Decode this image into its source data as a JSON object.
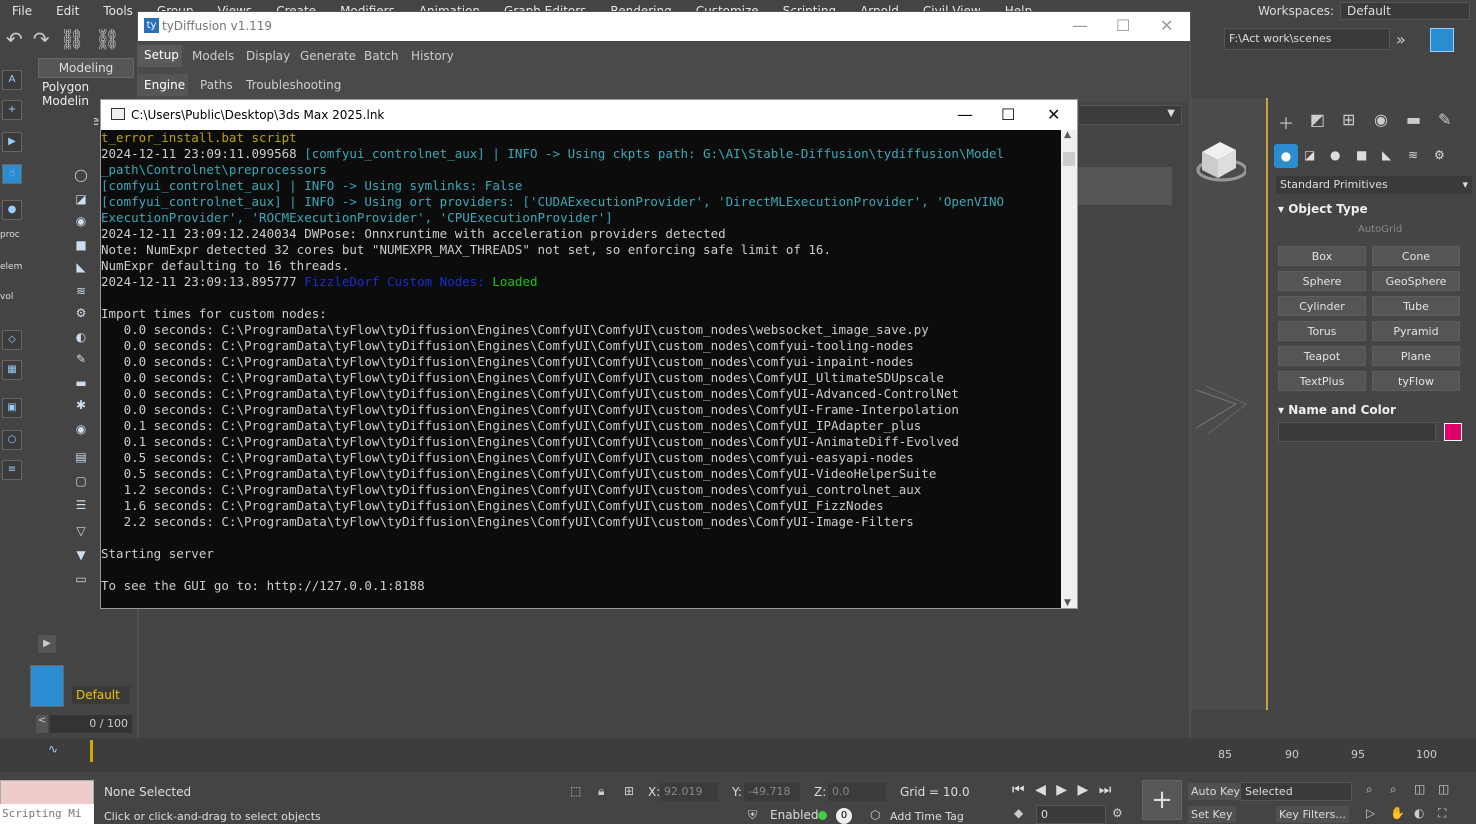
{
  "menubar": {
    "items": [
      "File",
      "Edit",
      "Tools",
      "Group",
      "Views",
      "Create",
      "Modifiers",
      "Animation",
      "Graph Editors",
      "Rendering",
      "Customize",
      "Scripting",
      "Arnold",
      "Civil View",
      "Help"
    ],
    "workspaces_label": "Workspaces:",
    "workspace": "Default"
  },
  "toolbar": {
    "path": "F:\\Act work\\scenes"
  },
  "ribbon": {
    "tab1": "Modeling",
    "tab2": "Polygon Modelin",
    "sel": "Se"
  },
  "lefticons": {
    "proc": "proc",
    "elem": "elem",
    "vol": "vol"
  },
  "cmd": {
    "default": "Default",
    "frame": "0 / 100"
  },
  "tydiffusion": {
    "title": "tyDiffusion v1.119",
    "tabs": [
      "Setup",
      "Models",
      "Display",
      "Generate",
      "Batch",
      "History"
    ],
    "subtabs": [
      "Engine",
      "Paths",
      "Troubleshooting"
    ]
  },
  "console": {
    "title": "C:\\Users\\Public\\Desktop\\3ds Max 2025.lnk",
    "lines": [
      {
        "cls": "dy",
        "text": "t_error_install.bat script"
      },
      {
        "parts": [
          {
            "c": "",
            "t": "2024-12-11 23:09:11.099568 "
          },
          {
            "c": "cy",
            "t": "[comfyui_controlnet_aux] | INFO -> Using ckpts path: G:\\AI\\Stable-Diffusion\\tydiffusion\\Model"
          }
        ]
      },
      {
        "cls": "cy",
        "text": "_path\\Controlnet\\preprocessors"
      },
      {
        "cls": "cy",
        "text": "[comfyui_controlnet_aux] | INFO -> Using symlinks: False"
      },
      {
        "cls": "cy",
        "text": "[comfyui_controlnet_aux] | INFO -> Using ort providers: ['CUDAExecutionProvider', 'DirectMLExecutionProvider', 'OpenVINO"
      },
      {
        "cls": "cy",
        "text": "ExecutionProvider', 'ROCMExecutionProvider', 'CPUExecutionProvider']"
      },
      {
        "cls": "",
        "text": "2024-12-11 23:09:12.240034 DWPose: Onnxruntime with acceleration providers detected"
      },
      {
        "cls": "",
        "text": "Note: NumExpr detected 32 cores but \"NUMEXPR_MAX_THREADS\" not set, so enforcing safe limit of 16."
      },
      {
        "cls": "",
        "text": "NumExpr defaulting to 16 threads."
      },
      {
        "parts": [
          {
            "c": "",
            "t": "2024-12-11 23:09:13.895777 "
          },
          {
            "c": "bl",
            "t": "FizzleDorf Custom Nodes: "
          },
          {
            "c": "gr",
            "t": "Loaded"
          }
        ]
      },
      {
        "cls": "",
        "text": ""
      },
      {
        "cls": "",
        "text": "Import times for custom nodes:"
      },
      {
        "cls": "",
        "text": "   0.0 seconds: C:\\ProgramData\\tyFlow\\tyDiffusion\\Engines\\ComfyUI\\ComfyUI\\custom_nodes\\websocket_image_save.py"
      },
      {
        "cls": "",
        "text": "   0.0 seconds: C:\\ProgramData\\tyFlow\\tyDiffusion\\Engines\\ComfyUI\\ComfyUI\\custom_nodes\\comfyui-tooling-nodes"
      },
      {
        "cls": "",
        "text": "   0.0 seconds: C:\\ProgramData\\tyFlow\\tyDiffusion\\Engines\\ComfyUI\\ComfyUI\\custom_nodes\\comfyui-inpaint-nodes"
      },
      {
        "cls": "",
        "text": "   0.0 seconds: C:\\ProgramData\\tyFlow\\tyDiffusion\\Engines\\ComfyUI\\ComfyUI\\custom_nodes\\ComfyUI_UltimateSDUpscale"
      },
      {
        "cls": "",
        "text": "   0.0 seconds: C:\\ProgramData\\tyFlow\\tyDiffusion\\Engines\\ComfyUI\\ComfyUI\\custom_nodes\\ComfyUI-Advanced-ControlNet"
      },
      {
        "cls": "",
        "text": "   0.0 seconds: C:\\ProgramData\\tyFlow\\tyDiffusion\\Engines\\ComfyUI\\ComfyUI\\custom_nodes\\ComfyUI-Frame-Interpolation"
      },
      {
        "cls": "",
        "text": "   0.1 seconds: C:\\ProgramData\\tyFlow\\tyDiffusion\\Engines\\ComfyUI\\ComfyUI\\custom_nodes\\ComfyUI_IPAdapter_plus"
      },
      {
        "cls": "",
        "text": "   0.1 seconds: C:\\ProgramData\\tyFlow\\tyDiffusion\\Engines\\ComfyUI\\ComfyUI\\custom_nodes\\ComfyUI-AnimateDiff-Evolved"
      },
      {
        "cls": "",
        "text": "   0.5 seconds: C:\\ProgramData\\tyFlow\\tyDiffusion\\Engines\\ComfyUI\\ComfyUI\\custom_nodes\\comfyui-easyapi-nodes"
      },
      {
        "cls": "",
        "text": "   0.5 seconds: C:\\ProgramData\\tyFlow\\tyDiffusion\\Engines\\ComfyUI\\ComfyUI\\custom_nodes\\ComfyUI-VideoHelperSuite"
      },
      {
        "cls": "",
        "text": "   1.2 seconds: C:\\ProgramData\\tyFlow\\tyDiffusion\\Engines\\ComfyUI\\ComfyUI\\custom_nodes\\comfyui_controlnet_aux"
      },
      {
        "cls": "",
        "text": "   1.6 seconds: C:\\ProgramData\\tyFlow\\tyDiffusion\\Engines\\ComfyUI\\ComfyUI\\custom_nodes\\ComfyUI_FizzNodes"
      },
      {
        "cls": "",
        "text": "   2.2 seconds: C:\\ProgramData\\tyFlow\\tyDiffusion\\Engines\\ComfyUI\\ComfyUI\\custom_nodes\\ComfyUI-Image-Filters"
      },
      {
        "cls": "",
        "text": ""
      },
      {
        "cls": "",
        "text": "Starting server"
      },
      {
        "cls": "",
        "text": ""
      },
      {
        "cls": "",
        "text": "To see the GUI go to: http://127.0.0.1:8188"
      }
    ]
  },
  "command_panel": {
    "dropdown": "Standard Primitives",
    "object_type": "Object Type",
    "autogrid": "AutoGrid",
    "objects": [
      "Box",
      "Cone",
      "Sphere",
      "GeoSphere",
      "Cylinder",
      "Tube",
      "Torus",
      "Pyramid",
      "Teapot",
      "Plane",
      "TextPlus",
      "tyFlow"
    ],
    "name_and_color": "Name and Color",
    "color": "#e1006a"
  },
  "timeline": {
    "ticks": [
      "85",
      "90",
      "95",
      "100"
    ]
  },
  "status": {
    "script": "Scripting Mi",
    "selection": "None Selected",
    "hint": "Click or click-and-drag to select objects",
    "x_label": "X:",
    "x": "92.019",
    "y_label": "Y:",
    "y": "-49.718",
    "z_label": "Z:",
    "z": "0.0",
    "grid": "Grid = 10.0",
    "enabled": "Enabled:",
    "zero": "0",
    "add_time_tag": "Add Time Tag",
    "auto_key": "Auto Key",
    "set_key": "Set Key",
    "selected": "Selected",
    "key_filters": "Key Filters...",
    "frame_field": "0"
  }
}
